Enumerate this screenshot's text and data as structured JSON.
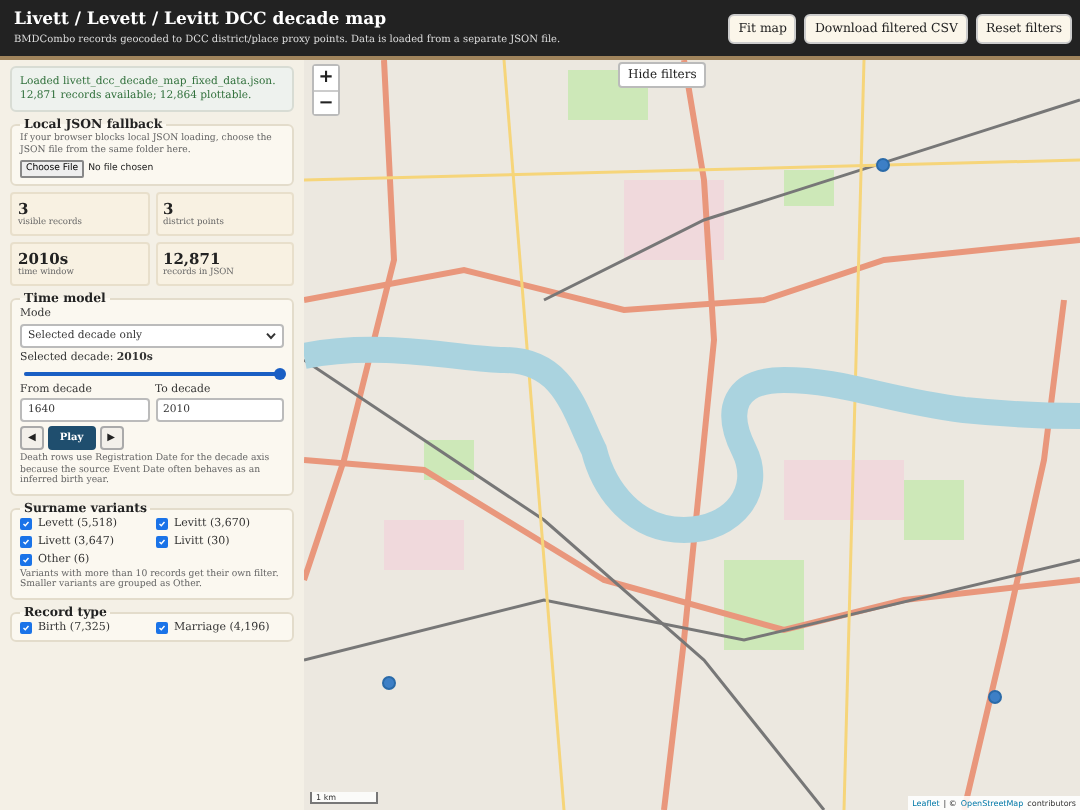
{
  "header": {
    "title": "Livett / Levett / Levitt DCC decade map",
    "subtitle": "BMDCombo records geocoded to DCC district/place proxy points. Data is loaded from a separate JSON file.",
    "buttons": [
      "Fit map",
      "Download filtered CSV",
      "Reset filters"
    ]
  },
  "status": "Loaded livett_dcc_decade_map_fixed_data.json. 12,871 records available; 12,864 plottable.",
  "fallback": {
    "title": "Local JSON fallback",
    "hint": "If your browser blocks local JSON loading, choose the JSON file from the same folder here.",
    "file_button": "Choose File",
    "file_status": "No file chosen"
  },
  "stats": [
    {
      "value": "3",
      "label": "visible records"
    },
    {
      "value": "3",
      "label": "district points"
    },
    {
      "value": "2010s",
      "label": "time window"
    },
    {
      "value": "12,871",
      "label": "records in JSON"
    }
  ],
  "time_model": {
    "title": "Time model",
    "mode_label": "Mode",
    "mode_value": "Selected decade only",
    "selected_label": "Selected decade:",
    "selected_value": "2010s",
    "slider": {
      "level": 1
    },
    "from_label": "From decade",
    "from_value": "1640",
    "to_label": "To decade",
    "to_value": "2010",
    "prev": "◀",
    "play": "Play",
    "next": "▶",
    "note": "Death rows use Registration Date for the decade axis because the source Event Date often behaves as an inferred birth year."
  },
  "surnames": {
    "title": "Surname variants",
    "items": [
      {
        "label": "Levett (5,518)",
        "checked": true
      },
      {
        "label": "Levitt (3,670)",
        "checked": true
      },
      {
        "label": "Livett (3,647)",
        "checked": true
      },
      {
        "label": "Livitt (30)",
        "checked": true
      },
      {
        "label": "Other (6)",
        "checked": true
      }
    ],
    "note": "Variants with more than 10 records get their own filter. Smaller variants are grouped as Other."
  },
  "record_type": {
    "title": "Record type",
    "items": [
      {
        "label": "Birth (7,325)",
        "checked": true
      },
      {
        "label": "Marriage (4,196)",
        "checked": true
      }
    ]
  },
  "map": {
    "hide_button": "Hide filters",
    "zoom_in": "+",
    "zoom_out": "−",
    "scale": "1 km",
    "attribution_link": "Leaflet",
    "attribution_sep": "| ©",
    "attribution_osm": "OpenStreetMap",
    "attribution_rest": "contributors"
  }
}
